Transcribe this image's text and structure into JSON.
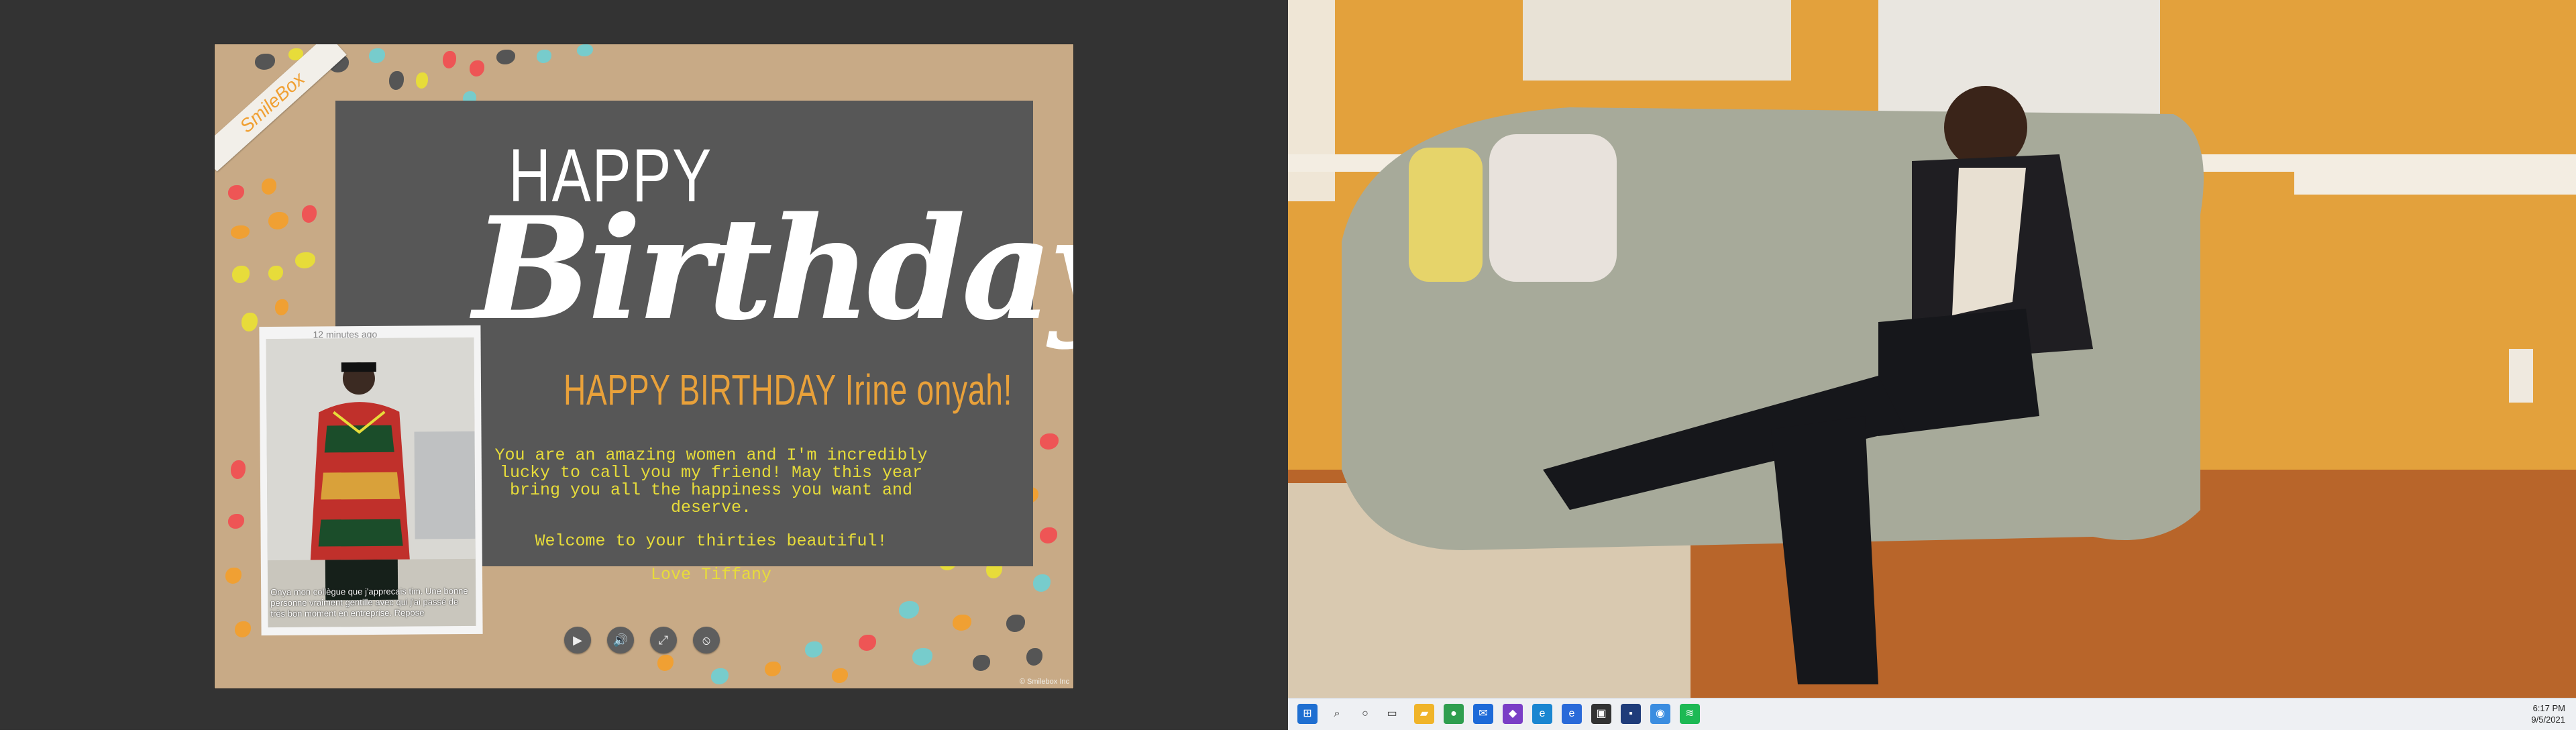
{
  "card": {
    "happy": "HAPPY",
    "birthday": "Birthday",
    "headline": "HAPPY BIRTHDAY Irine onyah!",
    "message_lines": [
      "You are an amazing women and I'm incredibly lucky to call you my friend! May this year bring you all the happiness you want and deserve.",
      "Welcome to your thirties beautiful!",
      "Love Tiffany"
    ],
    "logo": "SmileBox",
    "photo_time": "12 minutes ago",
    "photo_caption": "Onya mon collègue que j'apprecais tim. Une bonne personne vraiment gentille avec qui j'ai passé de très bon moment en entreprise. Repose",
    "copyright": "© Smilebox Inc"
  },
  "controls": {
    "play": "▶",
    "volume": "🔊",
    "fullscreen": "⤢",
    "mute_slash": "⦸"
  },
  "taskbar": {
    "time": "6:17 PM",
    "date": "9/5/2021"
  },
  "colors": {
    "card_bg": "#c8aa86",
    "panel": "#575757",
    "headline": "#e9a13a",
    "message": "#e7dc3a",
    "wall": "#e4a23a"
  }
}
